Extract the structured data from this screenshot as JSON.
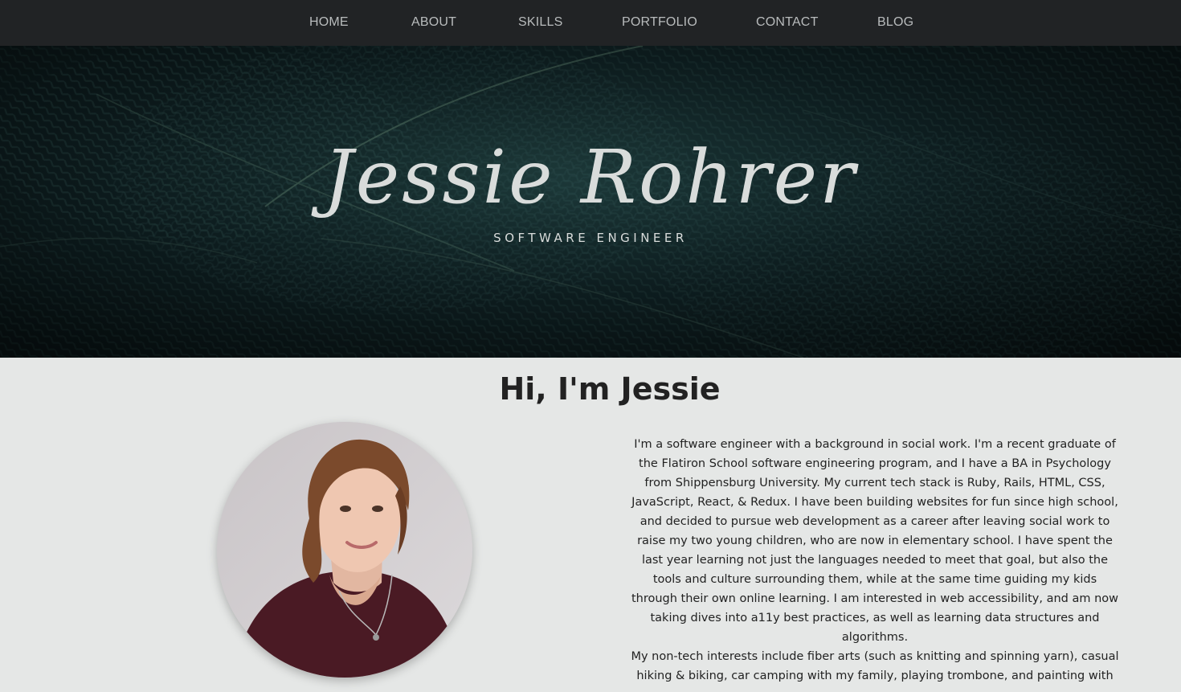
{
  "nav": {
    "items": [
      "HOME",
      "ABOUT",
      "SKILLS",
      "PORTFOLIO",
      "CONTACT",
      "BLOG"
    ]
  },
  "hero": {
    "name": "Jessie Rohrer",
    "subtitle": "SOFTWARE ENGINEER"
  },
  "about": {
    "heading": "Hi, I'm Jessie",
    "paragraphs": [
      "I'm a software engineer with a background in social work. I'm a recent graduate of the Flatiron School software engineering program, and I have a BA in Psychology from Shippensburg University. My current tech stack is Ruby, Rails, HTML, CSS, JavaScript, React, & Redux. I have been building websites for fun since high school, and decided to pursue web development as a career after leaving social work to raise my two young children, who are now in elementary school. I have spent the last year learning not just the languages needed to meet that goal, but also the tools and culture surrounding them, while at the same time guiding my kids through their own online learning. I am interested in web accessibility, and am now taking dives into a11y best practices, as well as learning data structures and algorithms.",
      "My non-tech interests include fiber arts (such as knitting and spinning yarn), casual hiking & biking, car camping with my family, playing trombone, and painting with"
    ]
  },
  "colors": {
    "nav_bg": "#212325",
    "page_bg": "#e5e7e6",
    "hero_bg": "#12272a",
    "hero_text": "#d9dcdb"
  }
}
